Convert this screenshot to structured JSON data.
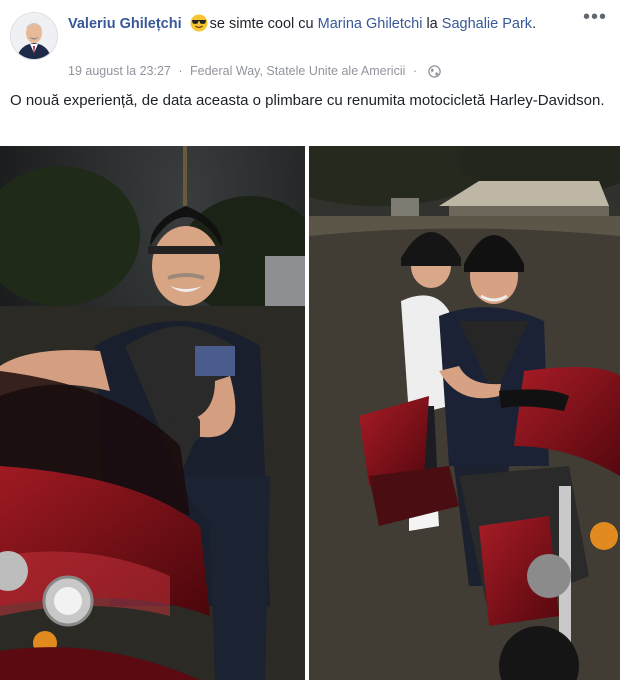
{
  "post": {
    "author": "Valeriu Ghilețchi",
    "activity": "se simte cool cu",
    "tagged_person": "Marina Ghiletchi",
    "at_word": "la",
    "place": "Saghalie Park",
    "place_suffix": ".",
    "timestamp": "19 august la 23:27",
    "location": "Federal Way, Statele Unite ale Americii",
    "privacy_icon": "globe-icon",
    "feeling_icon": "sunglasses-emoji-icon",
    "text": "O nouă experiență, de data aceasta o plimbare cu renumita motocicletă Harley-Davidson.",
    "more_icon": "ellipsis-icon"
  },
  "photos": [
    {
      "name": "photo-man-on-motorcycle"
    },
    {
      "name": "photo-couple-on-motorcycle"
    }
  ],
  "colors": {
    "link": "#385898",
    "meta": "#90949c",
    "bike_red": "#7a1018"
  }
}
